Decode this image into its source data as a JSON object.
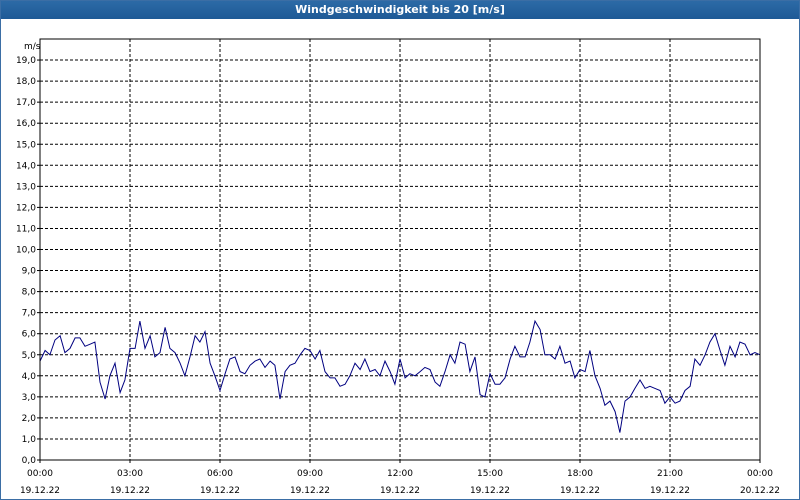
{
  "window": {
    "title": "Windgeschwindigkeit bis 20 [m/s]"
  },
  "chart_data": {
    "type": "line",
    "title": "Windgeschwindigkeit bis 20 [m/s]",
    "ylabel": "m/s",
    "ylim": [
      0,
      20
    ],
    "xlim_hours": [
      0,
      24
    ],
    "grid": true,
    "y_ticks": [
      "0,0",
      "1,0",
      "2,0",
      "3,0",
      "4,0",
      "5,0",
      "6,0",
      "7,0",
      "8,0",
      "9,0",
      "10,0",
      "11,0",
      "12,0",
      "13,0",
      "14,0",
      "15,0",
      "16,0",
      "17,0",
      "18,0",
      "19,0"
    ],
    "x_ticks": [
      {
        "time": "00:00",
        "date": "19.12.22"
      },
      {
        "time": "03:00",
        "date": "19.12.22"
      },
      {
        "time": "06:00",
        "date": "19.12.22"
      },
      {
        "time": "09:00",
        "date": "19.12.22"
      },
      {
        "time": "12:00",
        "date": "19.12.22"
      },
      {
        "time": "15:00",
        "date": "19.12.22"
      },
      {
        "time": "18:00",
        "date": "19.12.22"
      },
      {
        "time": "21:00",
        "date": "19.12.22"
      },
      {
        "time": "00:00",
        "date": "20.12.22"
      }
    ],
    "series": [
      {
        "color": "#000080",
        "x": [
          0.0,
          0.17,
          0.33,
          0.5,
          0.67,
          0.83,
          1.0,
          1.17,
          1.33,
          1.5,
          1.67,
          1.83,
          2.0,
          2.17,
          2.33,
          2.5,
          2.67,
          2.83,
          3.0,
          3.17,
          3.33,
          3.5,
          3.67,
          3.83,
          4.0,
          4.17,
          4.33,
          4.5,
          4.67,
          4.83,
          5.0,
          5.17,
          5.33,
          5.5,
          5.67,
          5.83,
          6.0,
          6.17,
          6.33,
          6.5,
          6.67,
          6.83,
          7.0,
          7.17,
          7.33,
          7.5,
          7.67,
          7.83,
          8.0,
          8.17,
          8.33,
          8.5,
          8.67,
          8.83,
          9.0,
          9.17,
          9.33,
          9.5,
          9.67,
          9.83,
          10.0,
          10.17,
          10.33,
          10.5,
          10.67,
          10.83,
          11.0,
          11.17,
          11.33,
          11.5,
          11.67,
          11.83,
          12.0,
          12.17,
          12.33,
          12.5,
          12.67,
          12.83,
          13.0,
          13.17,
          13.33,
          13.5,
          13.67,
          13.83,
          14.0,
          14.17,
          14.33,
          14.5,
          14.67,
          14.83,
          15.0,
          15.17,
          15.33,
          15.5,
          15.67,
          15.83,
          16.0,
          16.17,
          16.33,
          16.5,
          16.67,
          16.83,
          17.0,
          17.17,
          17.33,
          17.5,
          17.67,
          17.83,
          18.0,
          18.17,
          18.33,
          18.5,
          18.67,
          18.83,
          19.0,
          19.17,
          19.33,
          19.5,
          19.67,
          19.83,
          20.0,
          20.17,
          20.33,
          20.5,
          20.67,
          20.83,
          21.0,
          21.17,
          21.33,
          21.5,
          21.67,
          21.83,
          22.0,
          22.17,
          22.33,
          22.5,
          22.67,
          22.83,
          23.0,
          23.17,
          23.33,
          23.5,
          23.67,
          23.83,
          24.0
        ],
        "y": [
          4.7,
          5.2,
          5.0,
          5.7,
          5.9,
          5.1,
          5.3,
          5.8,
          5.8,
          5.4,
          5.5,
          5.6,
          3.7,
          2.9,
          4.0,
          4.6,
          3.2,
          3.8,
          5.3,
          5.3,
          6.6,
          5.3,
          5.9,
          4.9,
          5.1,
          6.3,
          5.3,
          5.1,
          4.6,
          4.0,
          4.9,
          5.9,
          5.6,
          6.1,
          4.6,
          4.0,
          3.3,
          4.1,
          4.8,
          4.9,
          4.2,
          4.1,
          4.5,
          4.7,
          4.8,
          4.4,
          4.7,
          4.5,
          2.9,
          4.2,
          4.5,
          4.6,
          5.0,
          5.3,
          5.2,
          4.8,
          5.2,
          4.2,
          3.9,
          3.9,
          3.5,
          3.6,
          4.0,
          4.6,
          4.3,
          4.8,
          4.2,
          4.3,
          4.0,
          4.7,
          4.2,
          3.6,
          4.8,
          3.9,
          4.1,
          4.0,
          4.2,
          4.4,
          4.3,
          3.7,
          3.5,
          4.2,
          5.0,
          4.6,
          5.6,
          5.5,
          4.2,
          4.9,
          3.1,
          3.0,
          4.1,
          3.6,
          3.6,
          3.9,
          4.8,
          5.4,
          4.9,
          4.9,
          5.6,
          6.6,
          6.2,
          5.0,
          5.0,
          4.8,
          5.4,
          4.6,
          4.7,
          3.9,
          4.3,
          4.2,
          5.2,
          4.0,
          3.4,
          2.6,
          2.8,
          2.3,
          1.3,
          2.8,
          3.0,
          3.4,
          3.8,
          3.4,
          3.5,
          3.4,
          3.3,
          2.7,
          3.0,
          2.7,
          2.8,
          3.3,
          3.5,
          4.8,
          4.5,
          5.0,
          5.6,
          6.0,
          5.2,
          4.5,
          5.4,
          4.9,
          5.6,
          5.5,
          5.0,
          5.1,
          5.0
        ]
      }
    ]
  }
}
